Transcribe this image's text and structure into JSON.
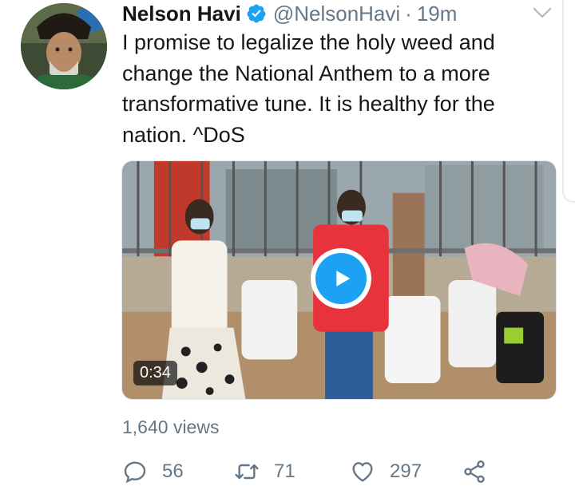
{
  "tweet": {
    "author_name": "Nelson Havi",
    "handle": "@NelsonHavi",
    "separator": "·",
    "time": "19m",
    "verified_icon": "verified-badge-icon",
    "text": "I promise to legalize the holy weed and change the National Anthem to a more transformative tune. It is healthy for the nation. ^DoS"
  },
  "media": {
    "duration": "0:34",
    "play_icon": "play-icon"
  },
  "stats": {
    "views": "1,640 views"
  },
  "actions": {
    "reply_count": "56",
    "retweet_count": "71",
    "like_count": "297"
  },
  "colors": {
    "accent": "#1da1f2",
    "muted": "#657786",
    "text": "#14171a"
  }
}
